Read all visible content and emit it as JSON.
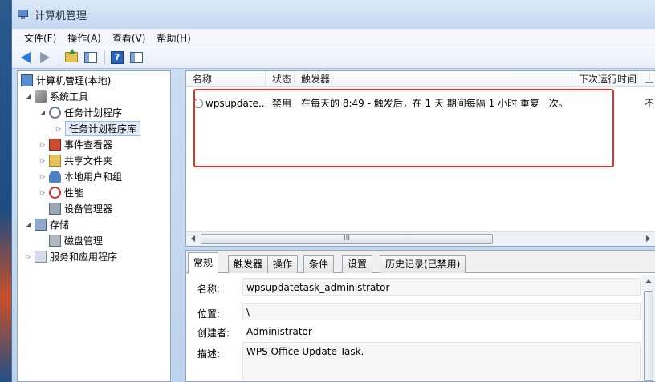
{
  "window": {
    "title": "计算机管理"
  },
  "menu": [
    "文件(F)",
    "操作(A)",
    "查看(V)",
    "帮助(H)"
  ],
  "toolbar": {
    "icons": [
      "back-arrow",
      "forward-arrow",
      "up-folder",
      "show-hide-tree",
      "help",
      "show-hide-action-pane"
    ]
  },
  "tree": {
    "root": "计算机管理(本地)",
    "system_tools": "系统工具",
    "task_scheduler": "任务计划程序",
    "task_library": "任务计划程序库",
    "event_viewer": "事件查看器",
    "shared_folders": "共享文件夹",
    "local_users": "本地用户和组",
    "performance": "性能",
    "device_manager": "设备管理器",
    "storage": "存储",
    "disk_management": "磁盘管理",
    "services_apps": "服务和应用程序"
  },
  "task_list": {
    "columns": [
      "名称",
      "状态",
      "触发器",
      "下次运行时间",
      "上次"
    ],
    "row": {
      "name": "wpsupdate...",
      "status": "禁用",
      "trigger": "在每天的 8:49 - 触发后，在 1 天 期间每隔 1 小时 重复一次。",
      "last_run": "不:"
    },
    "scroll_glyph": "III"
  },
  "details": {
    "tabs": [
      "常规",
      "触发器",
      "操作",
      "条件",
      "设置",
      "历史记录(已禁用)"
    ],
    "name_label": "名称:",
    "name_value": "wpsupdatetask_administrator",
    "location_label": "位置:",
    "location_value": "\\",
    "author_label": "创建者:",
    "author_value": "Administrator",
    "desc_label": "描述:",
    "desc_value": "WPS Office Update Task."
  },
  "colors": {
    "highlight_box": "#e0322a",
    "window_bg": "#bed3ee"
  }
}
